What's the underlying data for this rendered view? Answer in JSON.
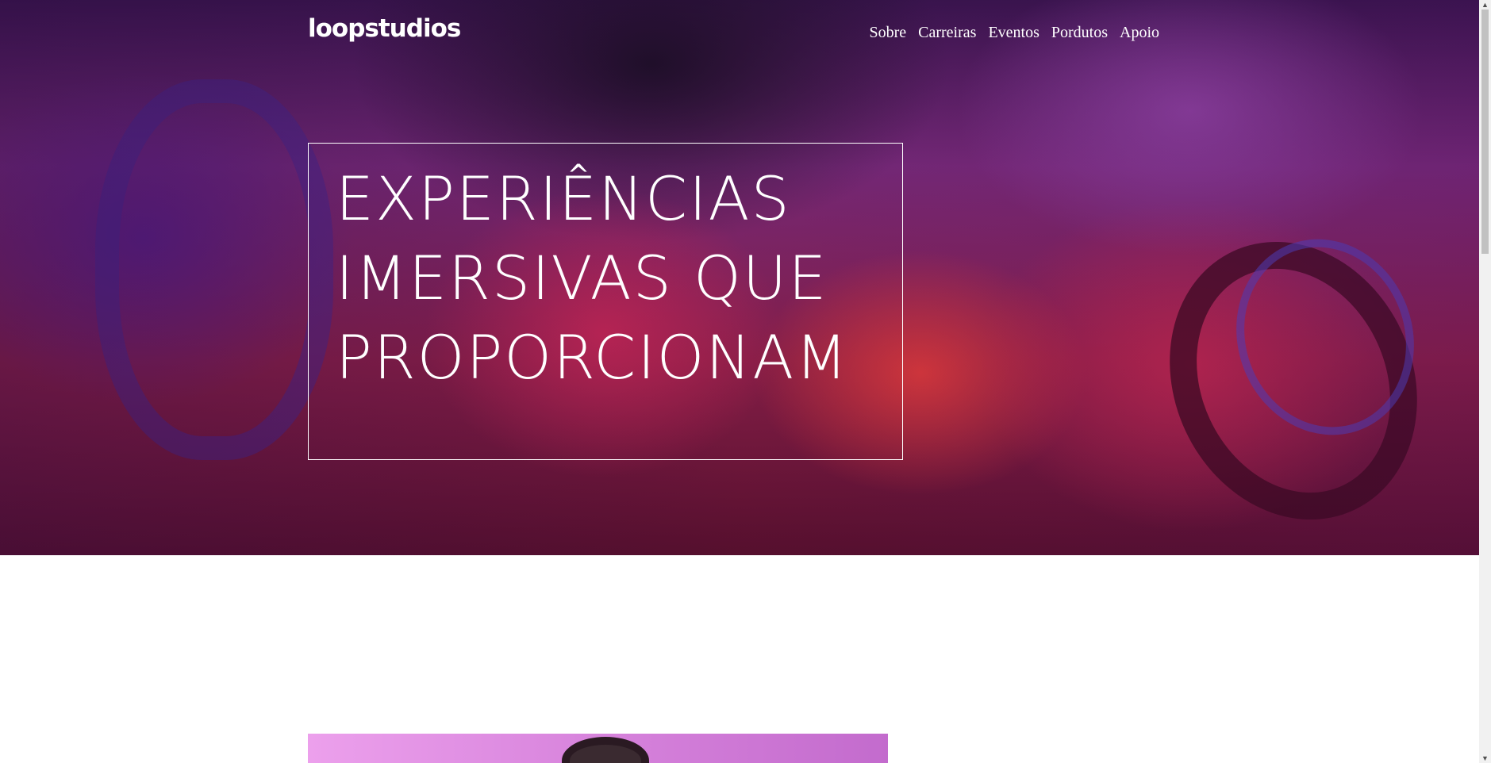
{
  "brand": {
    "logo": "loopstudios"
  },
  "nav": {
    "items": [
      {
        "label": "Sobre"
      },
      {
        "label": "Carreiras"
      },
      {
        "label": "Eventos"
      },
      {
        "label": "Pordutos"
      },
      {
        "label": "Apoio"
      }
    ]
  },
  "hero": {
    "headline_lines": [
      "EXPERIÊNCIAS",
      "IMERSIVAS QUE",
      "PROPORCIONAM"
    ]
  },
  "scrollbar": {
    "up_arrow": "▲",
    "down_arrow": "▼"
  },
  "icons": {
    "scroll_up": "chevron-up-icon",
    "scroll_down": "chevron-down-icon"
  }
}
